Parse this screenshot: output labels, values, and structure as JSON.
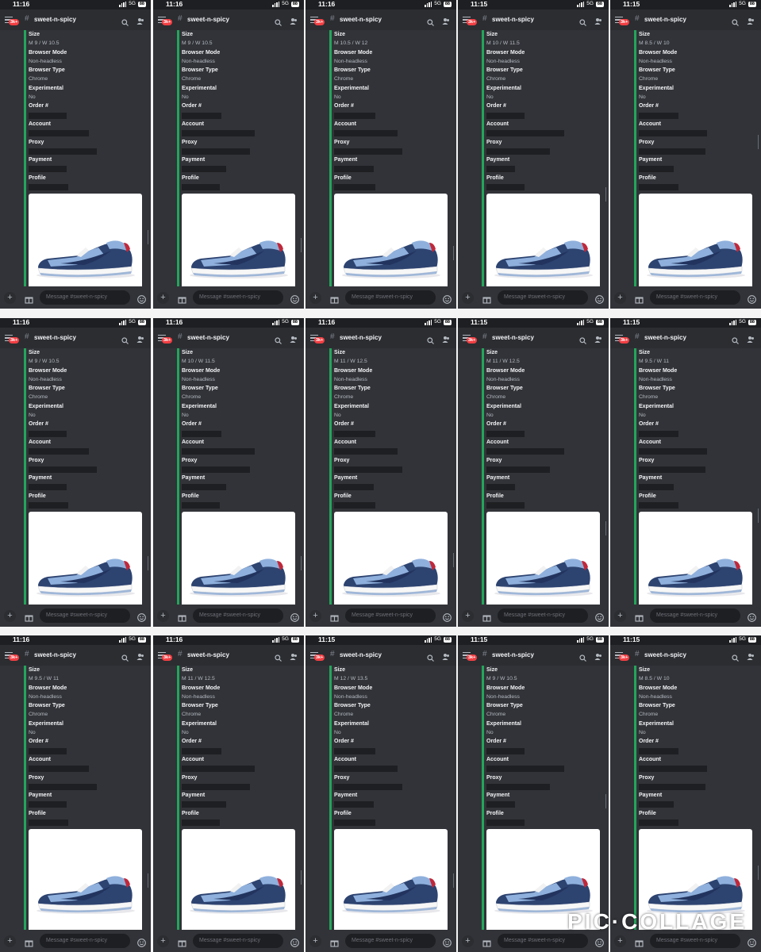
{
  "watermark": "PIC·COLLAGE",
  "colors": {
    "accent": "#23a55a",
    "background": "#313338",
    "badge": "#f23f43"
  },
  "channel": "sweet-n-spicy",
  "placeholder": "Message #sweet-n-spicy",
  "unread_badge": "3k+",
  "network": "5G",
  "battery": "88",
  "field_labels": {
    "size": "Size",
    "browser_mode": "Browser Mode",
    "browser_type": "Browser Type",
    "experimental": "Experimental",
    "order": "Order #",
    "account": "Account",
    "proxy": "Proxy",
    "payment": "Payment",
    "profile": "Profile"
  },
  "browser_mode_value": "Non-headless",
  "browser_type_value": "Chrome",
  "experimental_value": "No",
  "icons": [
    "menu-icon",
    "search-icon",
    "members-icon",
    "plus-icon",
    "gift-icon",
    "emoji-icon",
    "signal-icon",
    "battery-icon"
  ],
  "panels": [
    {
      "time": "11:16",
      "size": "M 9 / W 10.5"
    },
    {
      "time": "11:16",
      "size": "M 9 / W 10.5"
    },
    {
      "time": "11:16",
      "size": "M 10.5 / W 12"
    },
    {
      "time": "11:15",
      "size": "M 10 / W 11.5"
    },
    {
      "time": "11:15",
      "size": "M 8.5 / W 10"
    },
    {
      "time": "11:16",
      "size": "M 9 / W 10.5"
    },
    {
      "time": "11:16",
      "size": "M 10 / W 11.5"
    },
    {
      "time": "11:16",
      "size": "M 11 / W 12.5"
    },
    {
      "time": "11:15",
      "size": "M 11 / W 12.5"
    },
    {
      "time": "11:15",
      "size": "M 9.5 / W 11"
    },
    {
      "time": "11:16",
      "size": "M 9.5 / W 11"
    },
    {
      "time": "11:16",
      "size": "M 11 / W 12.5"
    },
    {
      "time": "11:15",
      "size": "M 12 / W 13.5"
    },
    {
      "time": "11:15",
      "size": "M 9 / W 10.5"
    },
    {
      "time": "11:15",
      "size": "M 8.5 / W 10"
    }
  ]
}
